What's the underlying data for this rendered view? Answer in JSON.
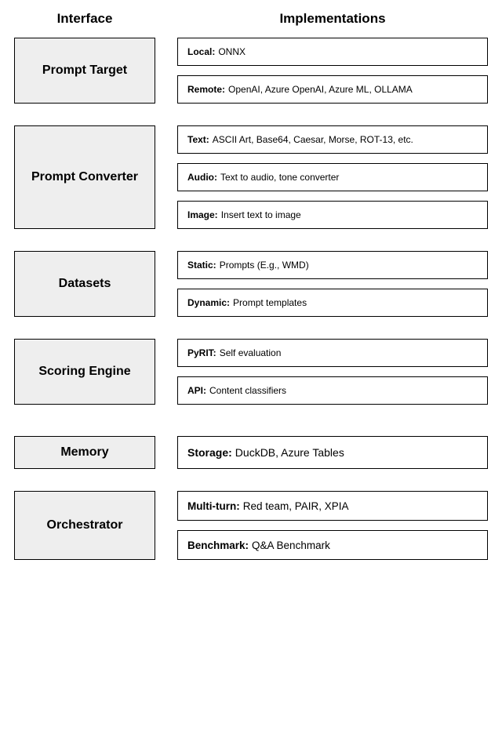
{
  "headers": {
    "interface": "Interface",
    "implementations": "Implementations"
  },
  "rows": [
    {
      "interface": "Prompt Target",
      "impls": [
        {
          "label": "Local:",
          "value": "ONNX"
        },
        {
          "label": "Remote:",
          "value": "OpenAI, Azure OpenAI, Azure ML, OLLAMA"
        }
      ]
    },
    {
      "interface": "Prompt Converter",
      "impls": [
        {
          "label": "Text:",
          "value": "ASCII Art, Base64, Caesar, Morse, ROT-13, etc."
        },
        {
          "label": "Audio:",
          "value": "Text to audio, tone converter"
        },
        {
          "label": "Image:",
          "value": "Insert text to image"
        }
      ]
    },
    {
      "interface": "Datasets",
      "impls": [
        {
          "label": "Static:",
          "value": "Prompts (E.g., WMD)"
        },
        {
          "label": "Dynamic:",
          "value": "Prompt templates"
        }
      ]
    },
    {
      "interface": "Scoring Engine",
      "impls": [
        {
          "label": "PyRIT:",
          "value": "Self evaluation"
        },
        {
          "label": "API:",
          "value": "Content classifiers"
        }
      ]
    },
    {
      "interface": "Memory",
      "impls": [
        {
          "label": "Storage:",
          "value": "DuckDB, Azure Tables"
        }
      ]
    },
    {
      "interface": "Orchestrator",
      "impls": [
        {
          "label": "Multi-turn:",
          "value": "Red team, PAIR, XPIA"
        },
        {
          "label": "Benchmark:",
          "value": "Q&A Benchmark"
        }
      ]
    }
  ]
}
